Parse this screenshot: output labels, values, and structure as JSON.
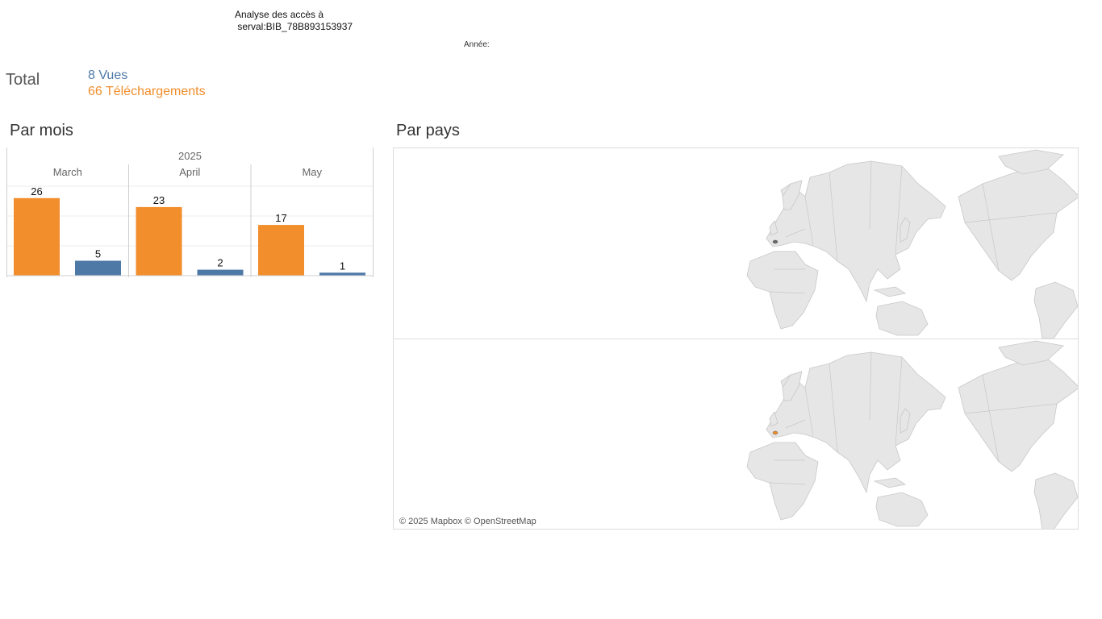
{
  "header": {
    "title": "Analyse des accès à\n serval:BIB_78B893153937",
    "year_label": "Année:"
  },
  "totals": {
    "label": "Total",
    "views": "8 Vues",
    "downloads": "66 Téléchargements"
  },
  "sections": {
    "by_month": "Par mois",
    "by_country": "Par pays"
  },
  "colors": {
    "views": "#4e79a7",
    "downloads": "#f28e2b",
    "land": "#e6e6e6",
    "country_border": "#c8c8c8"
  },
  "chart_data": {
    "type": "bar",
    "year": "2025",
    "categories": [
      "March",
      "April",
      "May"
    ],
    "series": [
      {
        "values": [
          26,
          23,
          17
        ],
        "color": "#f28e2b"
      },
      {
        "values": [
          5,
          2,
          1
        ],
        "color": "#4e79a7"
      }
    ],
    "ylim": [
      0,
      30
    ],
    "grid": true
  },
  "map": {
    "attribution": "© 2025 Mapbox © OpenStreetMap",
    "highlighted_country": "Switzerland"
  }
}
